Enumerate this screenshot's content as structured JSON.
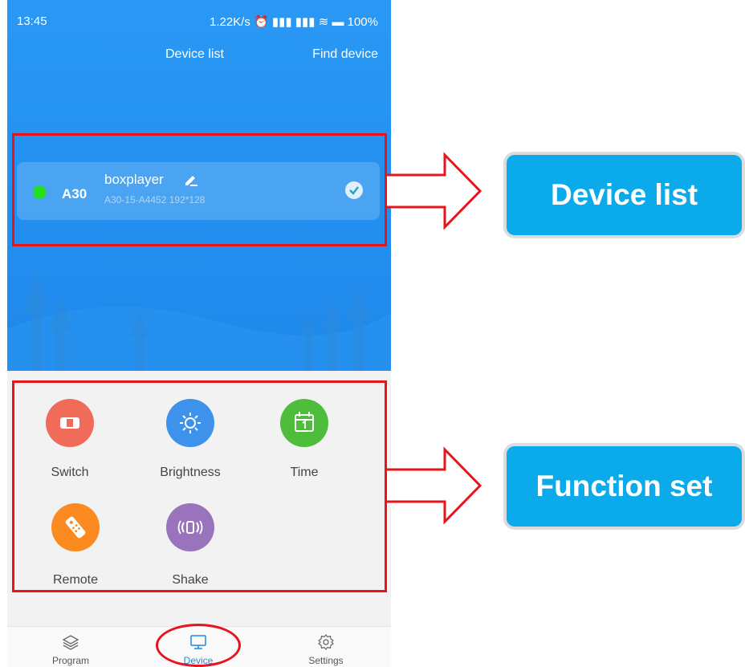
{
  "status_bar": {
    "time": "13:45",
    "indicators": "1.22K/s ⏰ ▮▮▮ ▮▮▮ ≋ ▬ 100%"
  },
  "header": {
    "title": "Device list",
    "action": "Find device"
  },
  "device": {
    "model": "A30",
    "name": "boxplayer",
    "info": "A30-15-A4452  192*128",
    "online_color": "#22dd22"
  },
  "functions": [
    {
      "label": "Switch",
      "icon": "power-switch-icon",
      "color": "#f16b5b"
    },
    {
      "label": "Brightness",
      "icon": "sun-icon",
      "color": "#3d92eb"
    },
    {
      "label": "Time",
      "icon": "calendar-icon",
      "color": "#4dbd3b"
    },
    {
      "label": "Remote",
      "icon": "remote-control-icon",
      "color": "#fb8b21"
    },
    {
      "label": "Shake",
      "icon": "shake-icon",
      "color": "#9a73bd"
    }
  ],
  "bottom_nav": [
    {
      "label": "Program",
      "icon": "layers-icon"
    },
    {
      "label": "Device",
      "icon": "monitor-icon",
      "active": true
    },
    {
      "label": "Settings",
      "icon": "gear-icon"
    }
  ],
  "callouts": {
    "device_list": "Device list",
    "function_set": "Function set"
  },
  "colors": {
    "primary_blue": "#2390f0",
    "annotation_red": "#e8141c",
    "callout_blue": "#0baaea"
  }
}
